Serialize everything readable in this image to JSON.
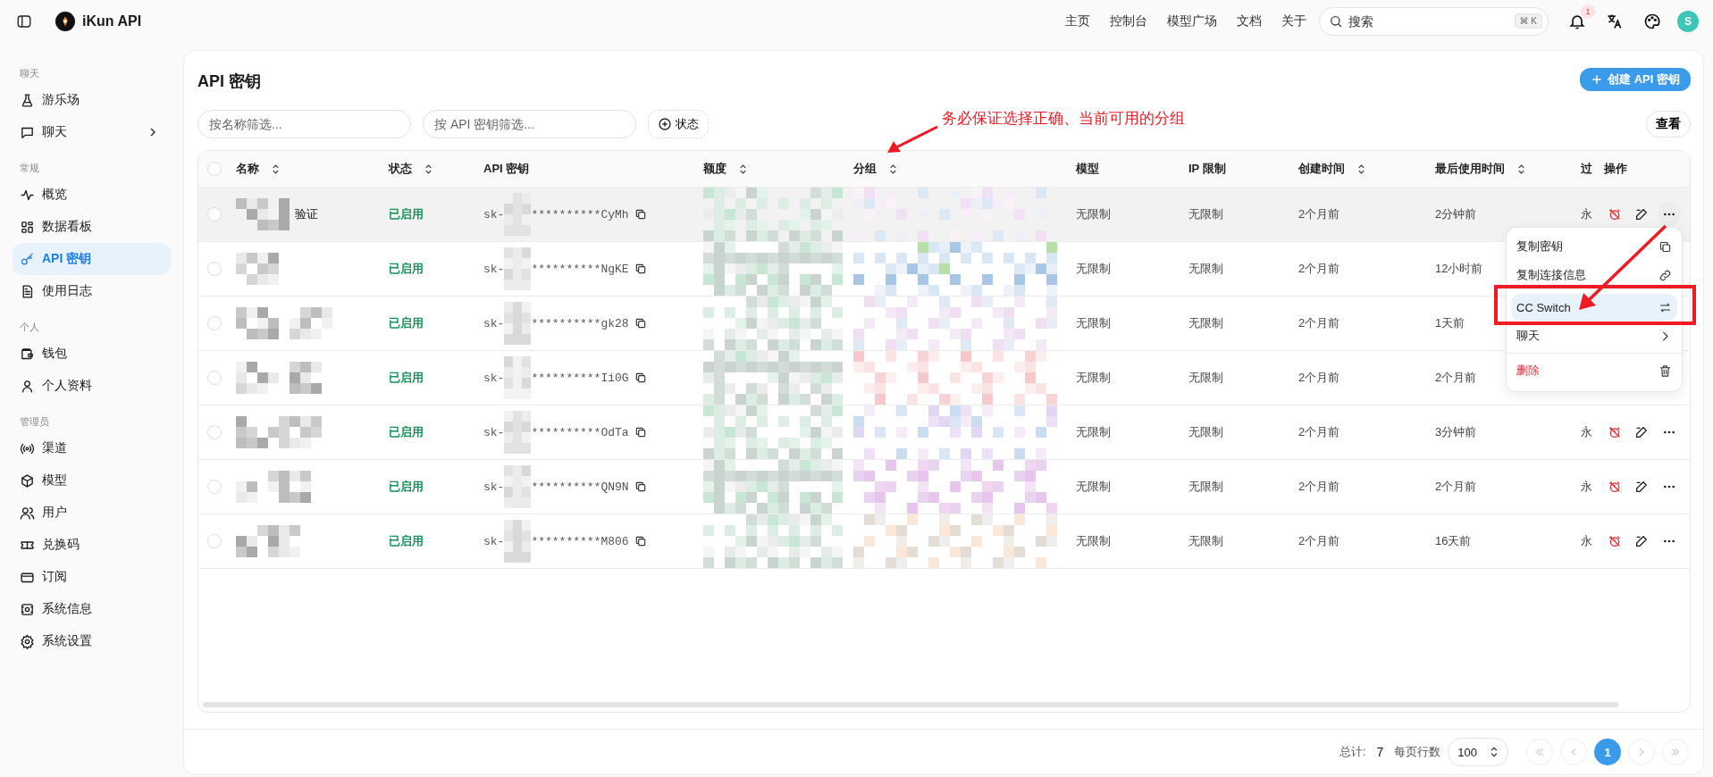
{
  "topbar": {
    "brand": "iKun API",
    "nav": [
      "主页",
      "控制台",
      "模型广场",
      "文档",
      "关于"
    ],
    "search": {
      "placeholder": "搜索",
      "shortcut": "⌘ K"
    },
    "notification_count": "1",
    "avatar": "S"
  },
  "sidebar": {
    "sections": [
      {
        "label": "聊天",
        "items": [
          {
            "label": "游乐场",
            "kind": "link",
            "selected": false
          },
          {
            "label": "聊天",
            "kind": "submenu",
            "selected": false
          }
        ]
      },
      {
        "label": "常规",
        "items": [
          {
            "label": "概览",
            "kind": "link",
            "selected": false
          },
          {
            "label": "数据看板",
            "kind": "link",
            "selected": false
          },
          {
            "label": "API 密钥",
            "kind": "link",
            "selected": true
          },
          {
            "label": "使用日志",
            "kind": "link",
            "selected": false
          }
        ]
      },
      {
        "label": "个人",
        "items": [
          {
            "label": "钱包",
            "kind": "link",
            "selected": false
          },
          {
            "label": "个人资料",
            "kind": "link",
            "selected": false
          }
        ]
      },
      {
        "label": "管理员",
        "items": [
          {
            "label": "渠道",
            "kind": "link",
            "selected": false
          },
          {
            "label": "模型",
            "kind": "link",
            "selected": false
          },
          {
            "label": "用户",
            "kind": "link",
            "selected": false
          },
          {
            "label": "兑换码",
            "kind": "link",
            "selected": false
          },
          {
            "label": "订阅",
            "kind": "link",
            "selected": false
          },
          {
            "label": "系统信息",
            "kind": "link",
            "selected": false
          },
          {
            "label": "系统设置",
            "kind": "link",
            "selected": false
          }
        ]
      }
    ]
  },
  "page": {
    "title": "API 密钥",
    "create_button": "创建 API 密钥",
    "filters": [
      {
        "placeholder": "按名称筛选..."
      },
      {
        "placeholder": "按 API 密钥筛选..."
      }
    ],
    "status_filter": "状态",
    "view_button": "查看"
  },
  "table": {
    "select_all_checked": false,
    "columns": [
      {
        "label": "名称",
        "sortable": true
      },
      {
        "label": "状态",
        "sortable": true
      },
      {
        "label": "API 密钥",
        "sortable": false
      },
      {
        "label": "额度",
        "sortable": true
      },
      {
        "label": "分组",
        "sortable": true
      },
      {
        "label": "模型",
        "sortable": false
      },
      {
        "label": "IP 限制",
        "sortable": false
      },
      {
        "label": "创建时间",
        "sortable": true
      },
      {
        "label": "最后使用时间",
        "sortable": true
      },
      {
        "label": "过"
      },
      {
        "label": "操作",
        "sortable": false
      }
    ],
    "rows": [
      {
        "name": "验证",
        "status": "已启用",
        "key_prefix": "sk-",
        "key_suffix": "**********CyMh",
        "model": "无限制",
        "ip": "无限制",
        "created": "2个月前",
        "last_used": "2分钟前",
        "expiry": "永",
        "checked": false,
        "highlighted": true
      },
      {
        "status": "已启用",
        "key_prefix": "sk-",
        "key_suffix": "**********NgKE",
        "model": "无限制",
        "ip": "无限制",
        "created": "2个月前",
        "last_used": "12小时前",
        "checked": false,
        "highlighted": false
      },
      {
        "status": "已启用",
        "key_prefix": "sk-",
        "key_suffix": "**********gk28",
        "model": "无限制",
        "ip": "无限制",
        "created": "2个月前",
        "last_used": "1天前",
        "checked": false,
        "highlighted": false
      },
      {
        "status": "已启用",
        "key_prefix": "sk-",
        "key_suffix": "**********Ii0G",
        "model": "无限制",
        "ip": "无限制",
        "created": "2个月前",
        "last_used": "2个月前",
        "checked": false,
        "highlighted": false
      },
      {
        "status": "已启用",
        "key_prefix": "sk-",
        "key_suffix": "**********OdTa",
        "model": "无限制",
        "ip": "无限制",
        "created": "2个月前",
        "last_used": "3分钟前",
        "expiry": "永",
        "checked": false,
        "highlighted": false
      },
      {
        "status": "已启用",
        "key_prefix": "sk-",
        "key_suffix": "**********QN9N",
        "model": "无限制",
        "ip": "无限制",
        "created": "2个月前",
        "last_used": "2个月前",
        "expiry": "永",
        "checked": false,
        "highlighted": false
      },
      {
        "status": "已启用",
        "key_prefix": "sk-",
        "key_suffix": "**********M806",
        "model": "无限制",
        "ip": "无限制",
        "created": "2个月前",
        "last_used": "16天前",
        "expiry": "永",
        "checked": false,
        "highlighted": false
      }
    ]
  },
  "menu": {
    "items": [
      {
        "label": "复制密钥",
        "kind": "action",
        "selected": false
      },
      {
        "label": "复制连接信息",
        "kind": "action",
        "selected": false
      },
      {
        "label": "CC Switch",
        "kind": "action",
        "selected": true
      },
      {
        "label": "聊天",
        "kind": "submenu",
        "selected": false
      },
      {
        "label": "删除",
        "kind": "danger",
        "selected": false
      }
    ]
  },
  "annotation": {
    "text": "务必保证选择正确、当前可用的分组"
  },
  "pagination": {
    "total_label": "总计:",
    "total": "7",
    "page_size_label": "每页行数",
    "page_size": "100",
    "nav_buttons": [
      {
        "kind": "first",
        "disabled": true
      },
      {
        "kind": "prev",
        "disabled": true
      },
      {
        "kind": "next",
        "disabled": true
      },
      {
        "kind": "last",
        "disabled": true
      }
    ],
    "pages": [
      {
        "label": "1",
        "selected": true
      }
    ]
  }
}
